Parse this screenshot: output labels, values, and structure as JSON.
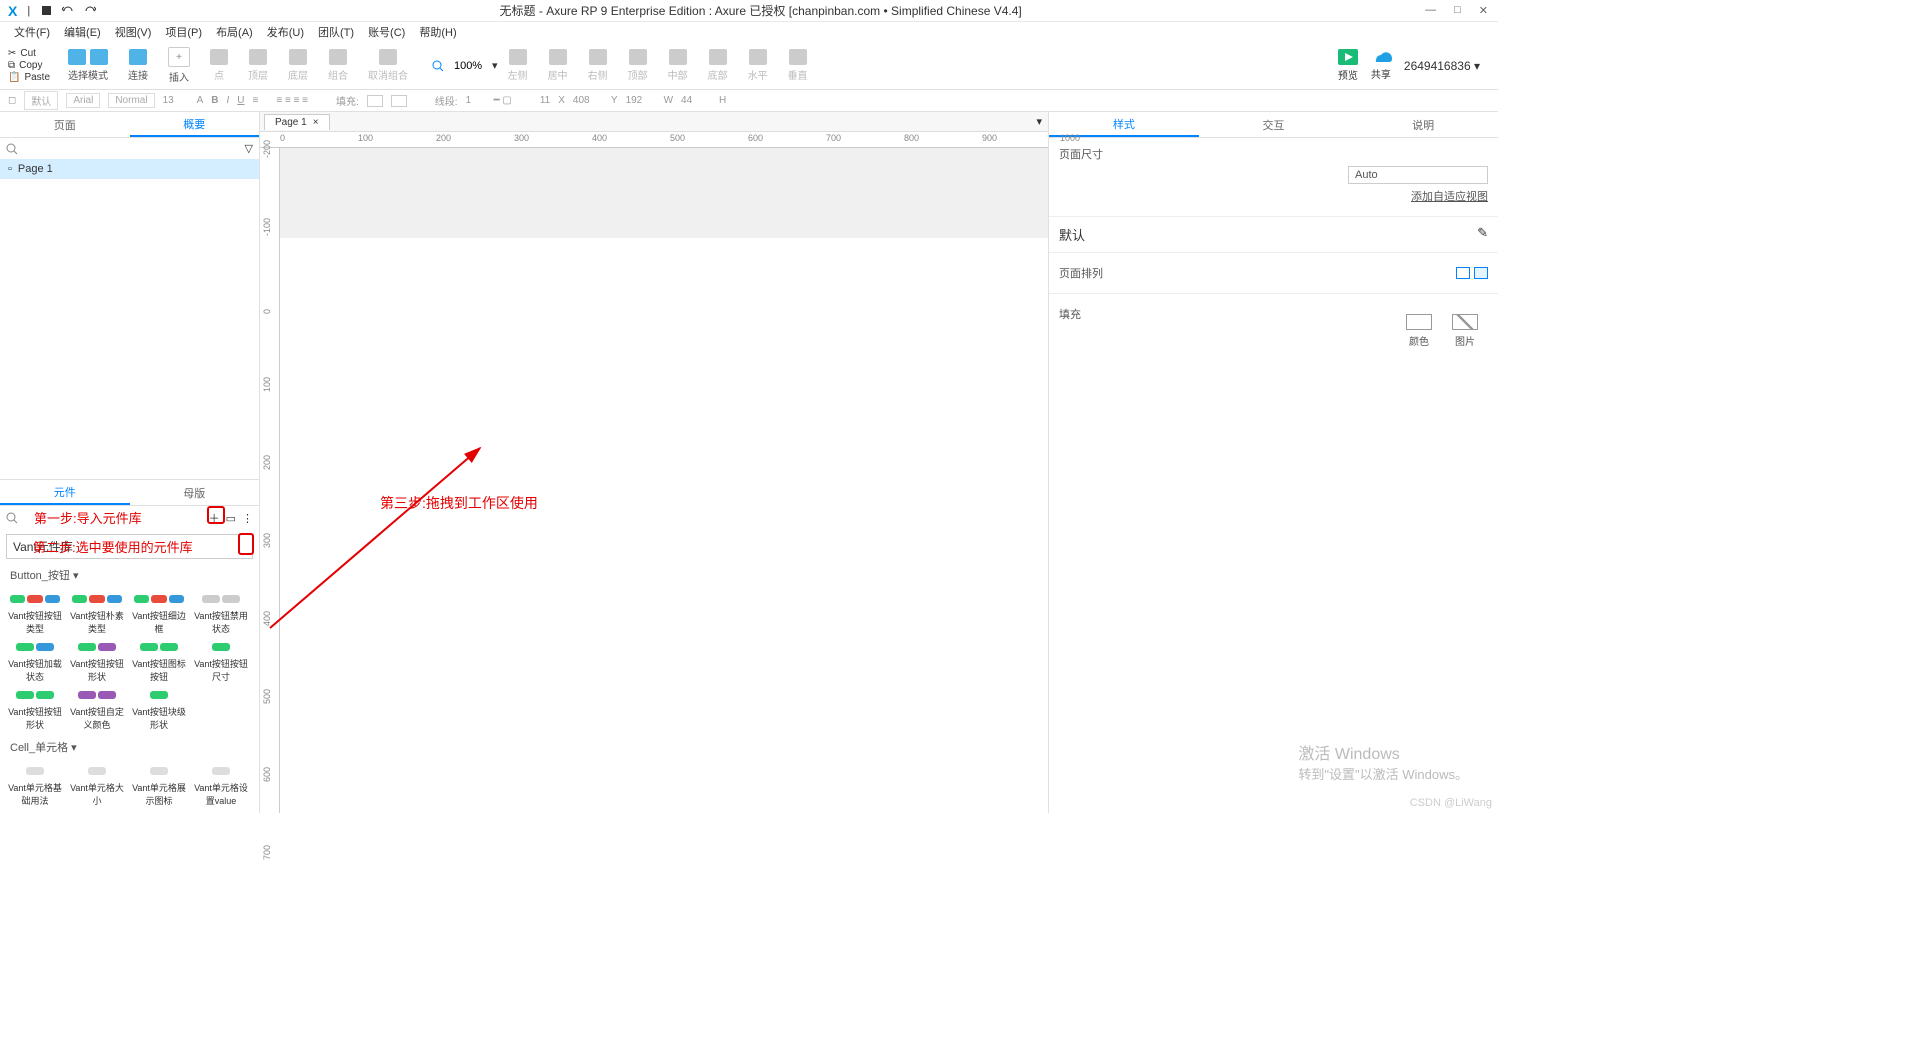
{
  "titlebar": {
    "title": "无标题 - Axure RP 9 Enterprise Edition : Axure 已授权     [chanpinban.com • Simplified Chinese V4.4]"
  },
  "menu": {
    "file": "文件(F)",
    "edit": "编辑(E)",
    "view": "视图(V)",
    "project": "项目(P)",
    "arrange": "布局(A)",
    "publish": "发布(U)",
    "team": "团队(T)",
    "account": "账号(C)",
    "help": "帮助(H)"
  },
  "clip": {
    "cut": "Cut",
    "copy": "Copy",
    "paste": "Paste"
  },
  "tools": {
    "select_mode": "选择模式",
    "connect": "连接",
    "insert": "插入",
    "point": "点",
    "top": "顶层",
    "bottom": "底层",
    "group": "组合",
    "ungroup": "取消组合",
    "zoom_value": "100%",
    "align_left": "左侧",
    "align_center": "居中",
    "align_right": "右侧",
    "align_top": "顶部",
    "align_middle": "中部",
    "align_bottom": "底部",
    "dist_h": "水平",
    "dist_v": "垂直",
    "preview": "预览",
    "share": "共享",
    "account_id": "2649416836"
  },
  "format": {
    "style_default": "默认",
    "font": "Arial",
    "weight": "Normal",
    "size": "13",
    "fill_label": "填充:",
    "line_label": "线段:",
    "line_w": "1",
    "x_label": "X",
    "x": "408",
    "y_label": "Y",
    "y": "192",
    "w_label": "W",
    "w": "44",
    "h_label": "H",
    "h": ""
  },
  "left": {
    "tab_pages": "页面",
    "tab_outline": "概要",
    "page1": "Page 1",
    "tab_widgets": "元件",
    "tab_masters": "母版",
    "step1": "第一步:导入元件库",
    "selected_lib": "Vant元件库",
    "step2": "第二步:选中要使用的元件库",
    "section_button": "Button_按钮 ▾",
    "section_cell": "Cell_单元格 ▾",
    "widgets_btn": [
      "Vant按钮按钮类型",
      "Vant按钮朴素类型",
      "Vant按钮细边框",
      "Vant按钮禁用状态",
      "Vant按钮加载状态",
      "Vant按钮按钮形状",
      "Vant按钮图标按钮",
      "Vant按钮按钮尺寸",
      "Vant按钮按钮形状",
      "Vant按钮自定义颜色",
      "Vant按钮块级形状"
    ],
    "widgets_cell": [
      "Vant单元格基础用法",
      "Vant单元格大小",
      "Vant单元格展示图标",
      "Vant单元格设置value"
    ]
  },
  "canvas": {
    "tab": "Page 1",
    "ruler_h": [
      "0",
      "100",
      "200",
      "300",
      "400",
      "500",
      "600",
      "700",
      "800",
      "900",
      "1000"
    ],
    "ruler_v": [
      "-200",
      "-100",
      "0",
      "100",
      "200",
      "300",
      "400",
      "500",
      "600",
      "700"
    ],
    "step3": "第三步:拖拽到工作区使用"
  },
  "right": {
    "tab_style": "样式",
    "tab_interact": "交互",
    "tab_notes": "说明",
    "page_size_label": "页面尺寸",
    "page_size_value": "Auto",
    "adaptive": "添加自适应视图",
    "default": "默认",
    "arrange": "页面排列",
    "fill": "填充",
    "color": "颜色",
    "image": "图片"
  },
  "watermark": {
    "l1": "激活 Windows",
    "l2": "转到\"设置\"以激活 Windows。"
  },
  "csdn": "CSDN @LiWang"
}
